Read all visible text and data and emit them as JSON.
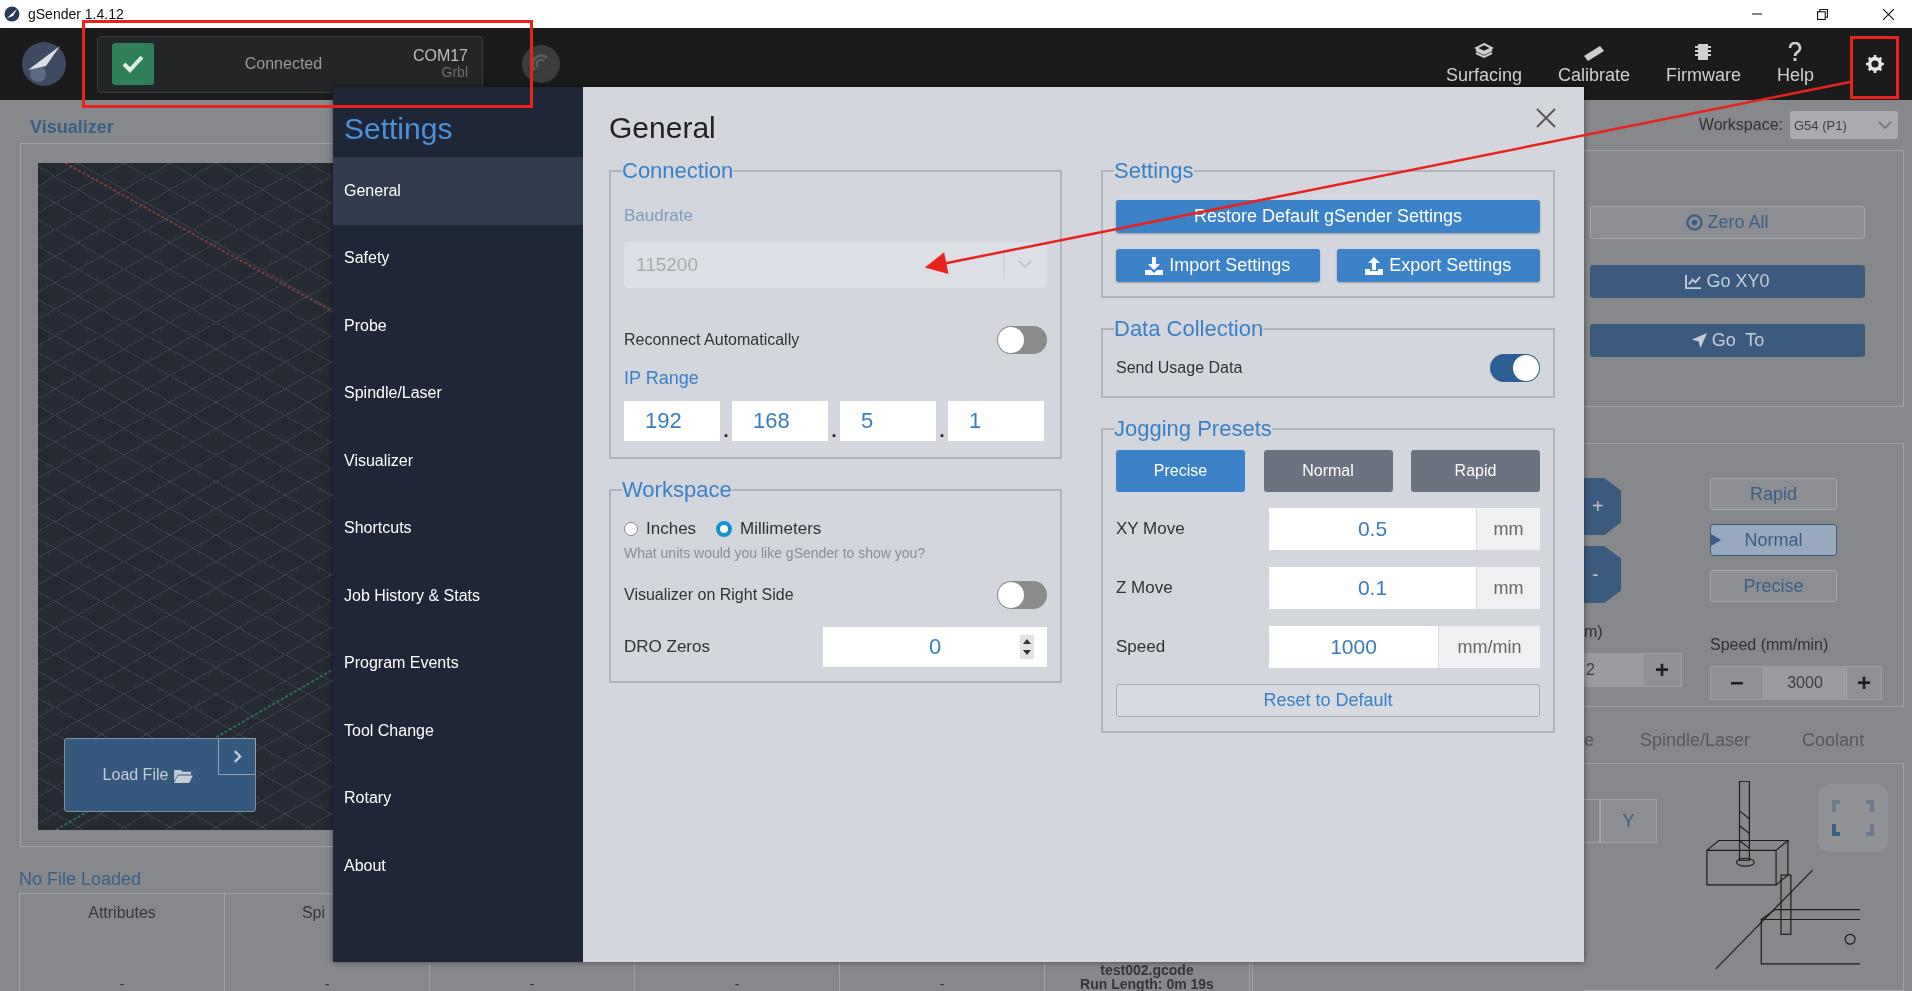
{
  "window": {
    "title": "gSender 1.4.12"
  },
  "header": {
    "connection": {
      "connected": true,
      "status": "Connected",
      "port": "COM17",
      "firmware": "Grbl"
    },
    "tools": [
      {
        "kind": "surfacing",
        "label": "Surfacing"
      },
      {
        "kind": "calibrate",
        "label": "Calibrate"
      },
      {
        "kind": "firmware",
        "label": "Firmware"
      },
      {
        "kind": "help",
        "label": "Help"
      }
    ]
  },
  "visualizer": {
    "title": "Visualizer",
    "load_button": "Load File"
  },
  "file_info": {
    "title": "No File Loaded",
    "columns": [
      "Attributes",
      "Spi"
    ],
    "values": [
      "-",
      "-",
      "-",
      "-",
      "-"
    ],
    "file_name": "test002.gcode",
    "run_length": "Run Length: 0m 19s"
  },
  "workspace_panel": {
    "label": "Workspace:",
    "value": "G54 (P1)",
    "buttons": [
      {
        "kind": "zero",
        "label": "Zero All"
      },
      {
        "kind": "chart",
        "label": "Go XY0"
      },
      {
        "kind": "goto",
        "label": "Go  To"
      }
    ]
  },
  "jog_panel": {
    "z_buttons": [
      "+",
      "-"
    ],
    "presets": [
      {
        "label": "Rapid",
        "selected": false
      },
      {
        "label": "Normal",
        "selected": true
      },
      {
        "label": "Precise",
        "selected": false
      }
    ],
    "step_label": "m)",
    "step_value": "2",
    "step_plus": "+",
    "speed_label": "Speed (mm/min)",
    "speed_minus": "−",
    "speed_value": "3000",
    "speed_plus": "+"
  },
  "tool_tabs": [
    "e",
    "Spindle/Laser",
    "Coolant"
  ],
  "probe_panel": {
    "axis_button": "Y"
  },
  "dialog": {
    "title": "Settings",
    "nav": [
      {
        "label": "General",
        "selected": true
      },
      {
        "label": "Safety",
        "selected": false
      },
      {
        "label": "Probe",
        "selected": false
      },
      {
        "label": "Spindle/Laser",
        "selected": false
      },
      {
        "label": "Visualizer",
        "selected": false
      },
      {
        "label": "Shortcuts",
        "selected": false
      },
      {
        "label": "Job History & Stats",
        "selected": false
      },
      {
        "label": "Program Events",
        "selected": false
      },
      {
        "label": "Tool Change",
        "selected": false
      },
      {
        "label": "Rotary",
        "selected": false
      },
      {
        "label": "About",
        "selected": false
      }
    ],
    "heading": "General",
    "connection": {
      "legend": "Connection",
      "baudrate_label": "Baudrate",
      "baudrate": "115200",
      "baudrate_disabled": true,
      "reconnect_label": "Reconnect Automatically",
      "reconnect_on": false,
      "ip_label": "IP Range",
      "ip": [
        "192",
        "168",
        "5",
        "1"
      ],
      "ip_separators": [
        ".",
        ".",
        "."
      ]
    },
    "workspace": {
      "legend": "Workspace",
      "units": [
        {
          "label": "Inches",
          "selected": false
        },
        {
          "label": "Millimeters",
          "selected": true
        }
      ],
      "hint": "What units would you like gSender to show you?",
      "visualizer_right_label": "Visualizer on Right Side",
      "visualizer_right_on": false,
      "dro_label": "DRO Zeros",
      "dro_value": "0"
    },
    "settings": {
      "legend": "Settings",
      "buttons": [
        {
          "kind": "restore",
          "label": "Restore Default gSender Settings"
        },
        {
          "kind": "import",
          "label": "Import Settings"
        },
        {
          "kind": "export",
          "label": "Export Settings"
        }
      ]
    },
    "data_collection": {
      "legend": "Data Collection",
      "send_usage_label": "Send Usage Data",
      "send_usage_on": true
    },
    "jogging": {
      "legend": "Jogging Presets",
      "presets": [
        {
          "label": "Precise",
          "selected": true
        },
        {
          "label": "Normal",
          "selected": false
        },
        {
          "label": "Rapid",
          "selected": false
        }
      ],
      "fields": [
        {
          "label": "XY Move",
          "value": "0.5",
          "unit": "mm"
        },
        {
          "label": "Z Move",
          "value": "0.1",
          "unit": "mm"
        },
        {
          "label": "Speed",
          "value": "1000",
          "unit": "mm/min"
        }
      ],
      "reset": "Reset to Default"
    }
  }
}
